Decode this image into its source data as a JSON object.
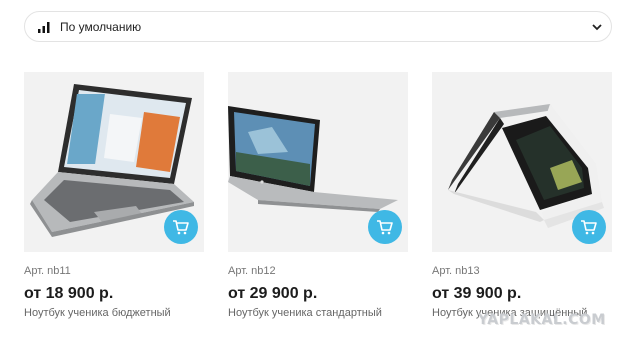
{
  "sort": {
    "label": "По умолчанию",
    "icon": "signal-bars-icon",
    "chevron": "chevron-down-icon"
  },
  "products": [
    {
      "sku": "Арт. nb11",
      "price": "от 18 900 р.",
      "description": "Ноутбук ученика бюджетный",
      "cart_icon": "cart-icon"
    },
    {
      "sku": "Арт. nb12",
      "price": "от 29 900 р.",
      "description": "Ноутбук ученика стандартный",
      "cart_icon": "cart-icon"
    },
    {
      "sku": "Арт. nb13",
      "price": "от 39 900 р.",
      "description": "Ноутбук ученика защищённый",
      "cart_icon": "cart-icon"
    }
  ],
  "watermark": "YAPLAKAL.COM",
  "colors": {
    "accent": "#3fb8e5",
    "card_bg": "#f2f2f2"
  }
}
